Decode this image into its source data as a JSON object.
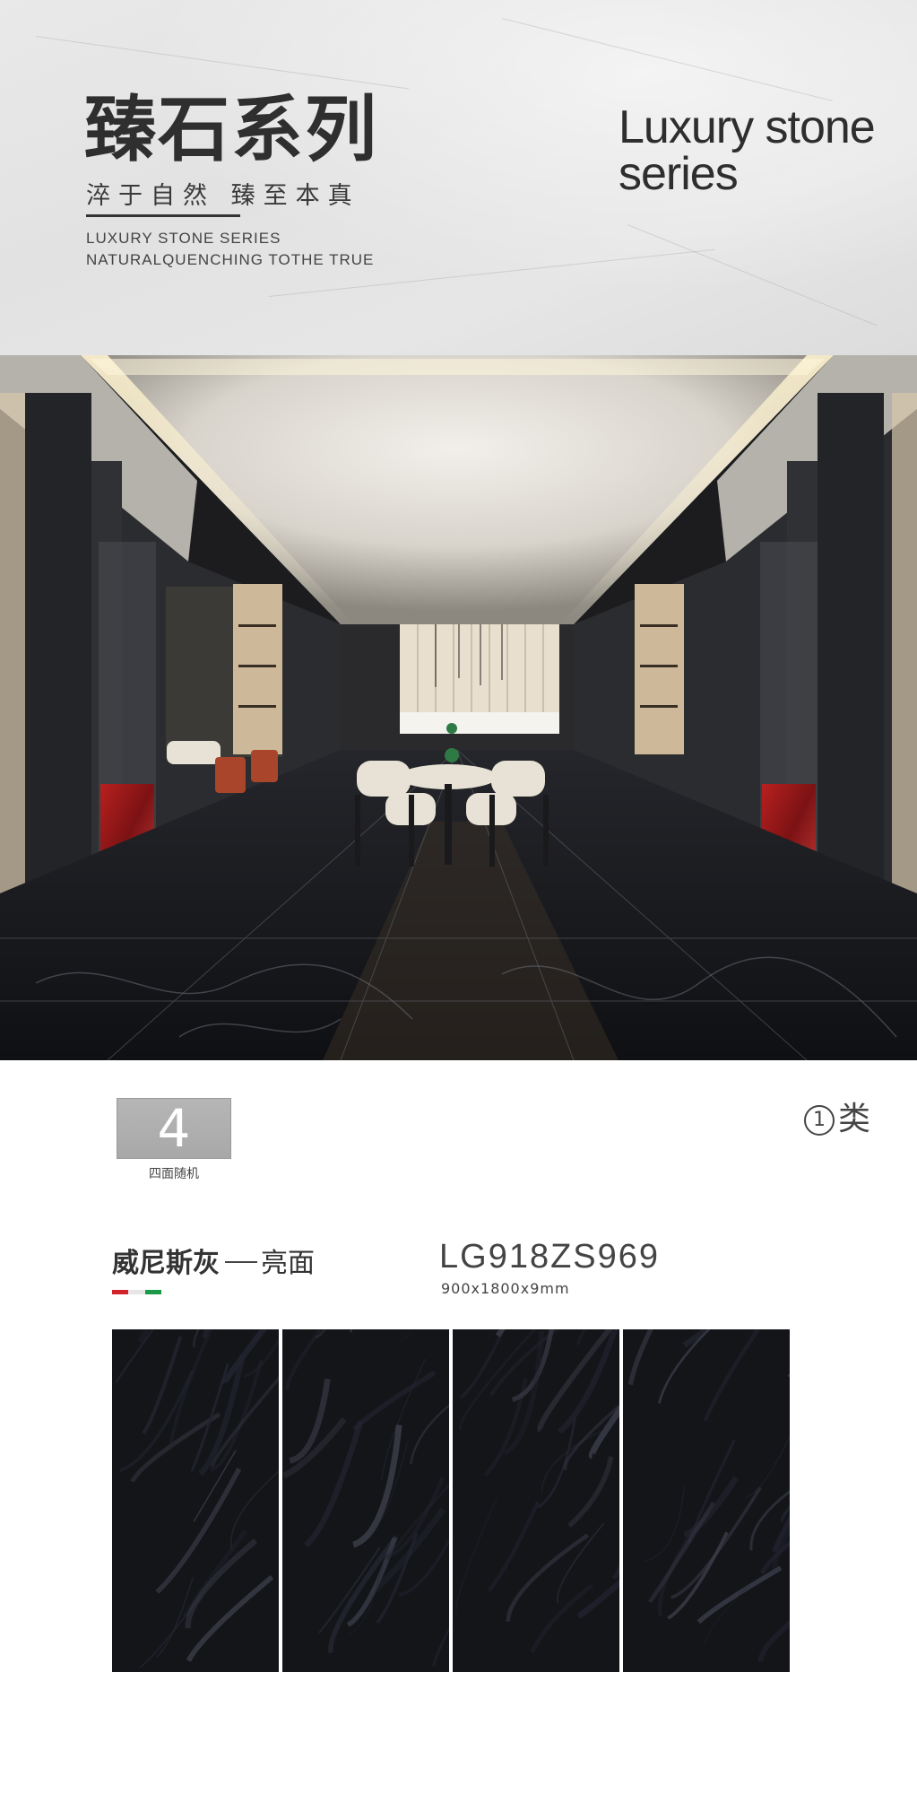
{
  "header": {
    "title_cn": "臻石系列",
    "subtitle_cn": "淬于自然 臻至本真",
    "en_line_1": "LUXURY STONE SERIES",
    "en_line_2": "NATURALQUENCHING TOTHE TRUE",
    "luxury_line_1": "Luxury stone",
    "luxury_line_2": "series"
  },
  "faces": {
    "count": "4",
    "label": "四面随机"
  },
  "grade": {
    "number": "1",
    "label": "类"
  },
  "product": {
    "name": "威尼斯灰",
    "finish": "亮面",
    "code": "LG918ZS969",
    "size": "900x1800x9mm",
    "flag_colors": [
      "#d2232a",
      "#e6e6e6",
      "#1a9a48"
    ]
  },
  "tiles": {
    "count": 4,
    "colors": [
      "#141519",
      "#222430",
      "#3a3c48"
    ]
  }
}
